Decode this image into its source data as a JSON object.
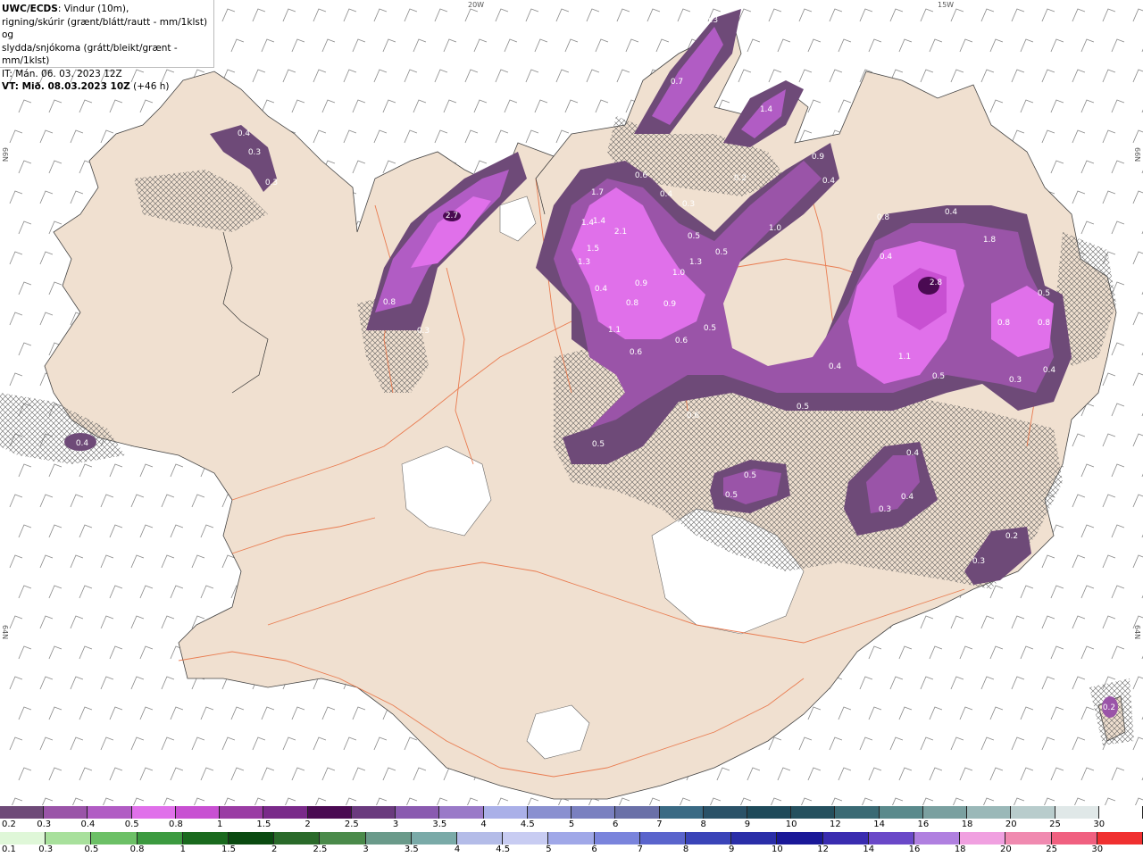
{
  "header": {
    "model": "UWC/ECDS",
    "line1_rest": ": Vindur (10m),",
    "line2": "rigning/skúrir (grænt/blátt/rautt - mm/1klst) og",
    "line3": "slydda/snjókoma (grátt/bleikt/grænt - mm/1klst)",
    "line4": "IT: Mán. 06. 03. 2023 12Z",
    "vt_label": "VT: Mið. 08.03.2023 10Z",
    "vt_offset": " (+46 h)"
  },
  "grid_labels": {
    "lon_20w": "20W",
    "lon_15w": "15W",
    "lat_66n_left": "66N",
    "lat_66n_right": "66N",
    "lat_64n_left": "64N",
    "lat_64n_right": "64N"
  },
  "value_labels": [
    "0.3",
    "0.7",
    "1.4",
    "0.4",
    "0.3",
    "0.3",
    "2.7",
    "1.7",
    "0.6",
    "0.4",
    "0.3",
    "0.2",
    "0.9",
    "0.4",
    "1.4",
    "1.4",
    "2.1",
    "1.5",
    "1.3",
    "0.5",
    "1.3",
    "1.0",
    "0.5",
    "1.0",
    "0.4",
    "0.9",
    "0.8",
    "0.9",
    "1.1",
    "0.6",
    "0.5",
    "0.6",
    "0.8",
    "0.3",
    "0.8",
    "0.4",
    "0.4",
    "1.8",
    "2.8",
    "0.5",
    "0.8",
    "0.8",
    "1.1",
    "0.5",
    "0.4",
    "0.3",
    "0.4",
    "0.5",
    "0.6",
    "0.5",
    "0.5",
    "0.5",
    "0.4",
    "0.3",
    "0.4",
    "0.2",
    "0.3",
    "0.4",
    "0.2"
  ],
  "legend_snow": {
    "labels": [
      "0.2",
      "0.3",
      "0.4",
      "0.5",
      "0.8",
      "1",
      "1.5",
      "2",
      "2.5",
      "3",
      "3.5",
      "4",
      "4.5",
      "5",
      "6",
      "7",
      "8",
      "9",
      "10",
      "12",
      "14",
      "16",
      "18",
      "20",
      "25",
      "30"
    ],
    "colors": [
      "#6e4a78",
      "#9a54a8",
      "#b15cc4",
      "#e070ea",
      "#c850d2",
      "#9a3ca4",
      "#7a2a8a",
      "#4a0a52",
      "#6a3a7e",
      "#8a5ab0",
      "#9a7ac8",
      "#aab0e8",
      "#8a90d0",
      "#7a80c0",
      "#6a70a8",
      "#3a6a84",
      "#2a5268",
      "#1e4a5a",
      "#24505e",
      "#3a6a74",
      "#5a8a8c",
      "#7aa0a0",
      "#9ab8b8",
      "#b8cccc",
      "#e0e8e8",
      "#ffffff"
    ]
  },
  "legend_rain": {
    "labels": [
      "0.1",
      "0.3",
      "0.5",
      "0.8",
      "1",
      "1.5",
      "2",
      "2.5",
      "3",
      "3.5",
      "4",
      "4.5",
      "5",
      "6",
      "7",
      "8",
      "9",
      "10",
      "12",
      "14",
      "16",
      "18",
      "20",
      "25",
      "30"
    ],
    "colors": [
      "#dff7d8",
      "#a8e09c",
      "#6cc066",
      "#3c9a40",
      "#1a6a1e",
      "#0a4a10",
      "#2a6a2a",
      "#4a8a4a",
      "#6a9a8a",
      "#7aaaa8",
      "#b4bce8",
      "#c8ccf2",
      "#a0a8e8",
      "#7a84dc",
      "#5a64cc",
      "#3a44b8",
      "#2a2ea8",
      "#1a1898",
      "#3a2cb0",
      "#6a48c8",
      "#b080e0",
      "#f0a0e0",
      "#f08ab0",
      "#f06080",
      "#f03030"
    ]
  }
}
